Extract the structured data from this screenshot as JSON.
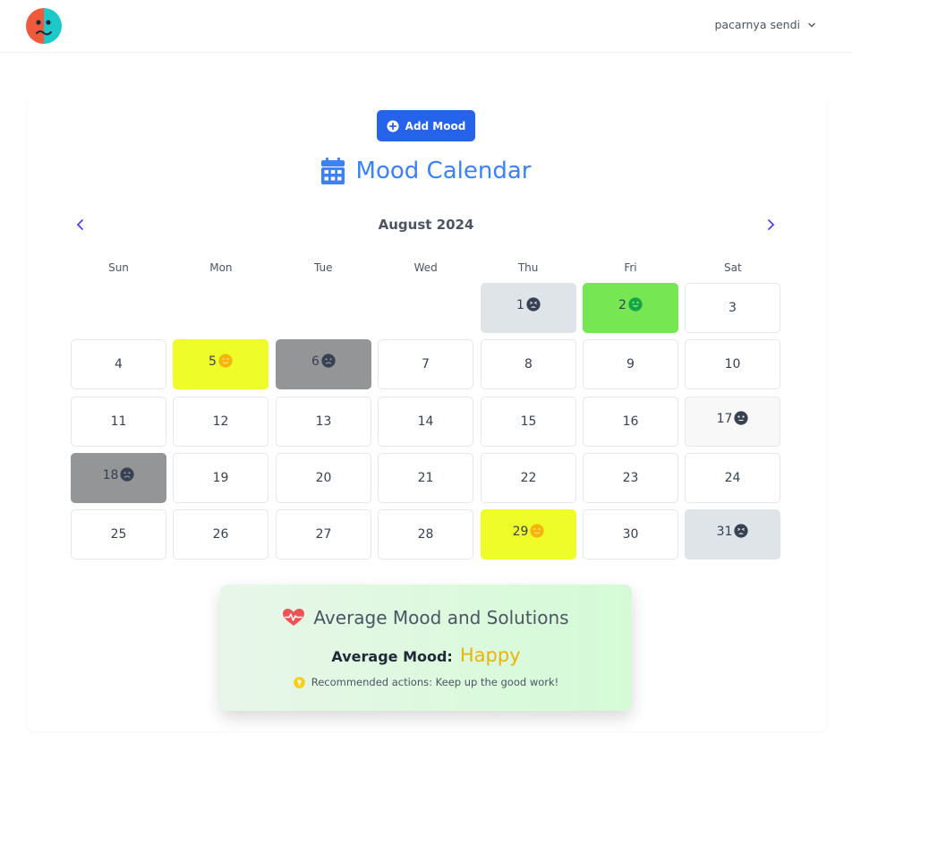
{
  "user": {
    "name": "pacarnya sendi"
  },
  "add_button": {
    "label": "Add Mood"
  },
  "calendar": {
    "title": "Mood Calendar",
    "month": "August 2024",
    "weekdays": [
      "Sun",
      "Mon",
      "Tue",
      "Wed",
      "Thu",
      "Fri",
      "Sat"
    ],
    "first_weekday_index": 4,
    "days_in_month": 31,
    "moods": {
      "1": {
        "bg": "#dfe4e8",
        "emoji": "tired"
      },
      "2": {
        "bg": "#76e653",
        "emoji": "happy"
      },
      "5": {
        "bg": "#eefc2a",
        "emoji": "smile"
      },
      "6": {
        "bg": "#939597",
        "emoji": "sad"
      },
      "17": {
        "bg": "#f8f8f8",
        "emoji": "neutral"
      },
      "18": {
        "bg": "#939597",
        "emoji": "sad"
      },
      "29": {
        "bg": "#eefc2a",
        "emoji": "smile"
      },
      "31": {
        "bg": "#dfe4e8",
        "emoji": "tired"
      }
    }
  },
  "summary": {
    "title": "Average Mood and Solutions",
    "avg_label": "Average Mood:",
    "avg_value": "Happy",
    "recommendation": "Recommended actions: Keep up the good work!"
  },
  "colors": {
    "accent": "#2563eb",
    "title_blue": "#3b82f6",
    "avg_value": "#eab308",
    "heart": "#f05252"
  },
  "icons": {
    "logo": "mood-face-logo-icon",
    "user_chevron": "chevron-down-icon",
    "add": "plus-circle-icon",
    "title": "calendar-icon",
    "prev": "chevron-left-icon",
    "next": "chevron-right-icon",
    "summary": "heart-pulse-icon",
    "recommendation": "lightbulb-icon"
  }
}
